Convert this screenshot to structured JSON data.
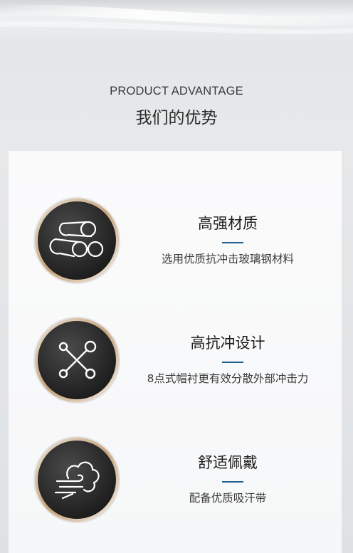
{
  "header": {
    "subtitle": "PRODUCT ADVANTAGE",
    "title": "我们的优势"
  },
  "features": [
    {
      "icon": "pipes-icon",
      "title": "高强材质",
      "description": "选用优质抗冲击玻璃钢材料"
    },
    {
      "icon": "network-icon",
      "title": "高抗冲设计",
      "description": "8点式帽衬更有效分散外部冲击力"
    },
    {
      "icon": "wind-icon",
      "title": "舒适佩戴",
      "description": "配备优质吸汗带"
    }
  ],
  "colors": {
    "accent_line": "#1f5f8c",
    "icon_circle": "#2a2a2a",
    "icon_ring_gold": "#c8a57a"
  }
}
